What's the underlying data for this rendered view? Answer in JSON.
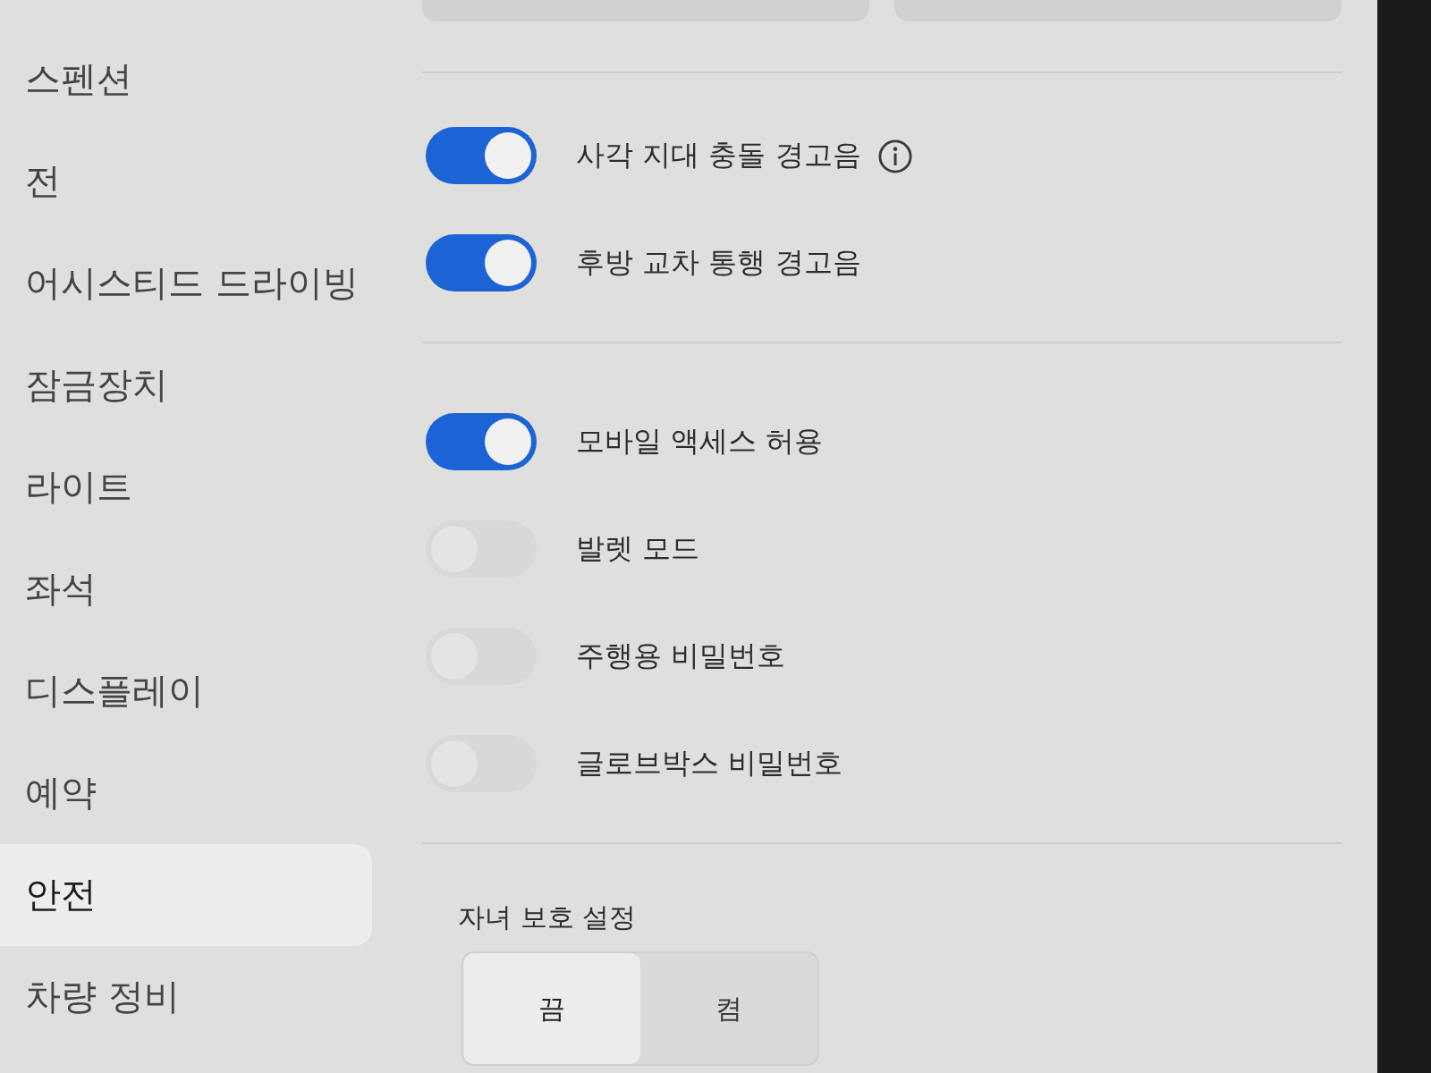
{
  "sidebar": {
    "items": [
      {
        "label": "스펜션",
        "selected": false
      },
      {
        "label": "전",
        "selected": false
      },
      {
        "label": "어시스티드 드라이빙",
        "selected": false
      },
      {
        "label": "잠금장치",
        "selected": false
      },
      {
        "label": "라이트",
        "selected": false
      },
      {
        "label": "좌석",
        "selected": false
      },
      {
        "label": "디스플레이",
        "selected": false
      },
      {
        "label": "예약",
        "selected": false
      },
      {
        "label": "안전",
        "selected": true
      },
      {
        "label": "차량 정비",
        "selected": false
      }
    ]
  },
  "sections": [
    {
      "toggles": [
        {
          "label": "사각 지대 충돌 경고음",
          "on": true,
          "info": true
        },
        {
          "label": "후방 교차 통행 경고음",
          "on": true,
          "info": false
        }
      ]
    },
    {
      "toggles": [
        {
          "label": "모바일 액세스 허용",
          "on": true,
          "info": false
        },
        {
          "label": "발렛 모드",
          "on": false,
          "info": false
        },
        {
          "label": "주행용 비밀번호",
          "on": false,
          "info": false
        },
        {
          "label": "글로브박스 비밀번호",
          "on": false,
          "info": false
        }
      ]
    }
  ],
  "child_lock": {
    "title": "자녀 보호 설정",
    "options": [
      {
        "label": "끔",
        "selected": true
      },
      {
        "label": "켬",
        "selected": false
      }
    ]
  }
}
